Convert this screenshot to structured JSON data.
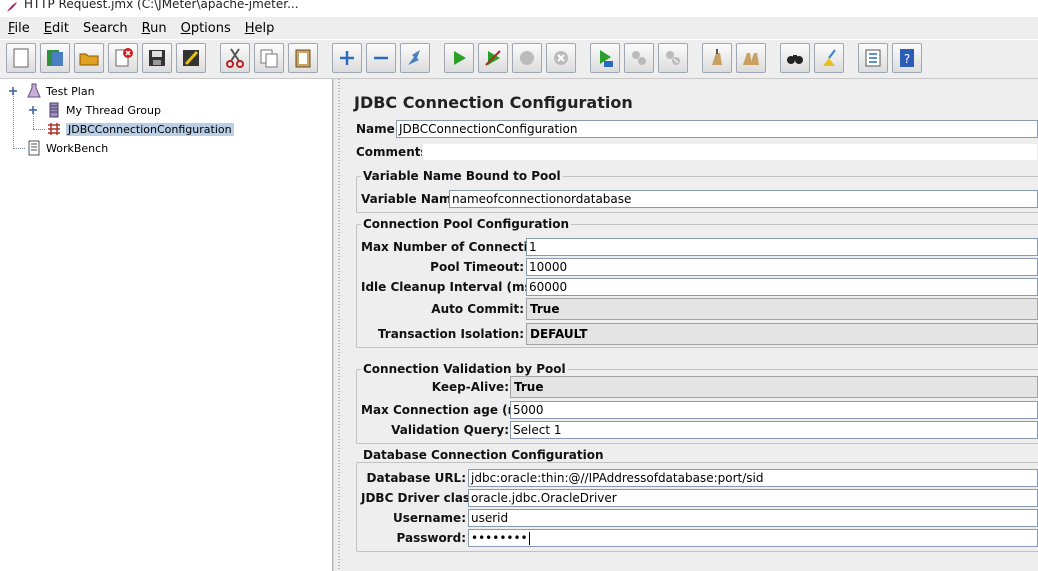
{
  "window": {
    "title": "HTTP Request.jmx (C:\\JMeter\\apache-jmeter..."
  },
  "menubar": [
    {
      "key": "F",
      "rest": "ile"
    },
    {
      "key": "E",
      "rest": "dit"
    },
    {
      "key": "",
      "rest": "Search"
    },
    {
      "key": "R",
      "rest": "un"
    },
    {
      "key": "O",
      "rest": "ptions"
    },
    {
      "key": "H",
      "rest": "elp"
    }
  ],
  "toolbar": {
    "buttons": [
      "new-icon",
      "templates-icon",
      "open-icon",
      "close-icon",
      "save-icon",
      "save-as-icon",
      "cut-icon",
      "copy-icon",
      "paste-icon",
      "expand-icon",
      "collapse-icon",
      "toggle-icon",
      "start-icon",
      "start-no-pause-icon",
      "stop-icon",
      "shutdown-icon",
      "remote-start-icon",
      "remote-stop-icon",
      "remote-shutdown-icon",
      "clear-icon",
      "clear-all-icon",
      "search-icon",
      "reset-search-icon",
      "function-helper-icon",
      "help-icon"
    ]
  },
  "tree": {
    "test_plan": "Test Plan",
    "thread_group": "My Thread Group",
    "jdbc_config": "JDBCConnectionConfiguration",
    "workbench": "WorkBench"
  },
  "config": {
    "heading": "JDBC Connection Configuration",
    "name_label": "Name:",
    "name_value": "JDBCConnectionConfiguration",
    "comments_label": "Comments:",
    "comments_value": "",
    "var_group": "Variable Name Bound to Pool",
    "var_name_label": "Variable Name:",
    "var_name_value": "nameofconnectionordatabase",
    "pool_group": "Connection Pool Configuration",
    "max_conn_label": "Max Number of Connections:",
    "max_conn_value": "1",
    "pool_timeout_label": "Pool Timeout:",
    "pool_timeout_value": "10000",
    "idle_label": "Idle Cleanup Interval (ms):",
    "idle_value": "60000",
    "auto_commit_label": "Auto Commit:",
    "auto_commit_value": "True",
    "isolation_label": "Transaction Isolation:",
    "isolation_value": "DEFAULT",
    "validation_group": "Connection Validation by Pool",
    "keepalive_label": "Keep-Alive:",
    "keepalive_value": "True",
    "max_age_label": "Max Connection age (ms):",
    "max_age_value": "5000",
    "validation_query_label": "Validation Query:",
    "validation_query_value": "Select 1",
    "db_group": "Database Connection Configuration",
    "db_url_label": "Database URL:",
    "db_url_value": "jdbc:oracle:thin:@//IPAddressofdatabase:port/sid",
    "driver_label": "JDBC Driver class:",
    "driver_value": "oracle.jdbc.OracleDriver",
    "username_label": "Username:",
    "username_value": "userid",
    "password_label": "Password:",
    "password_value": "••••••••"
  }
}
